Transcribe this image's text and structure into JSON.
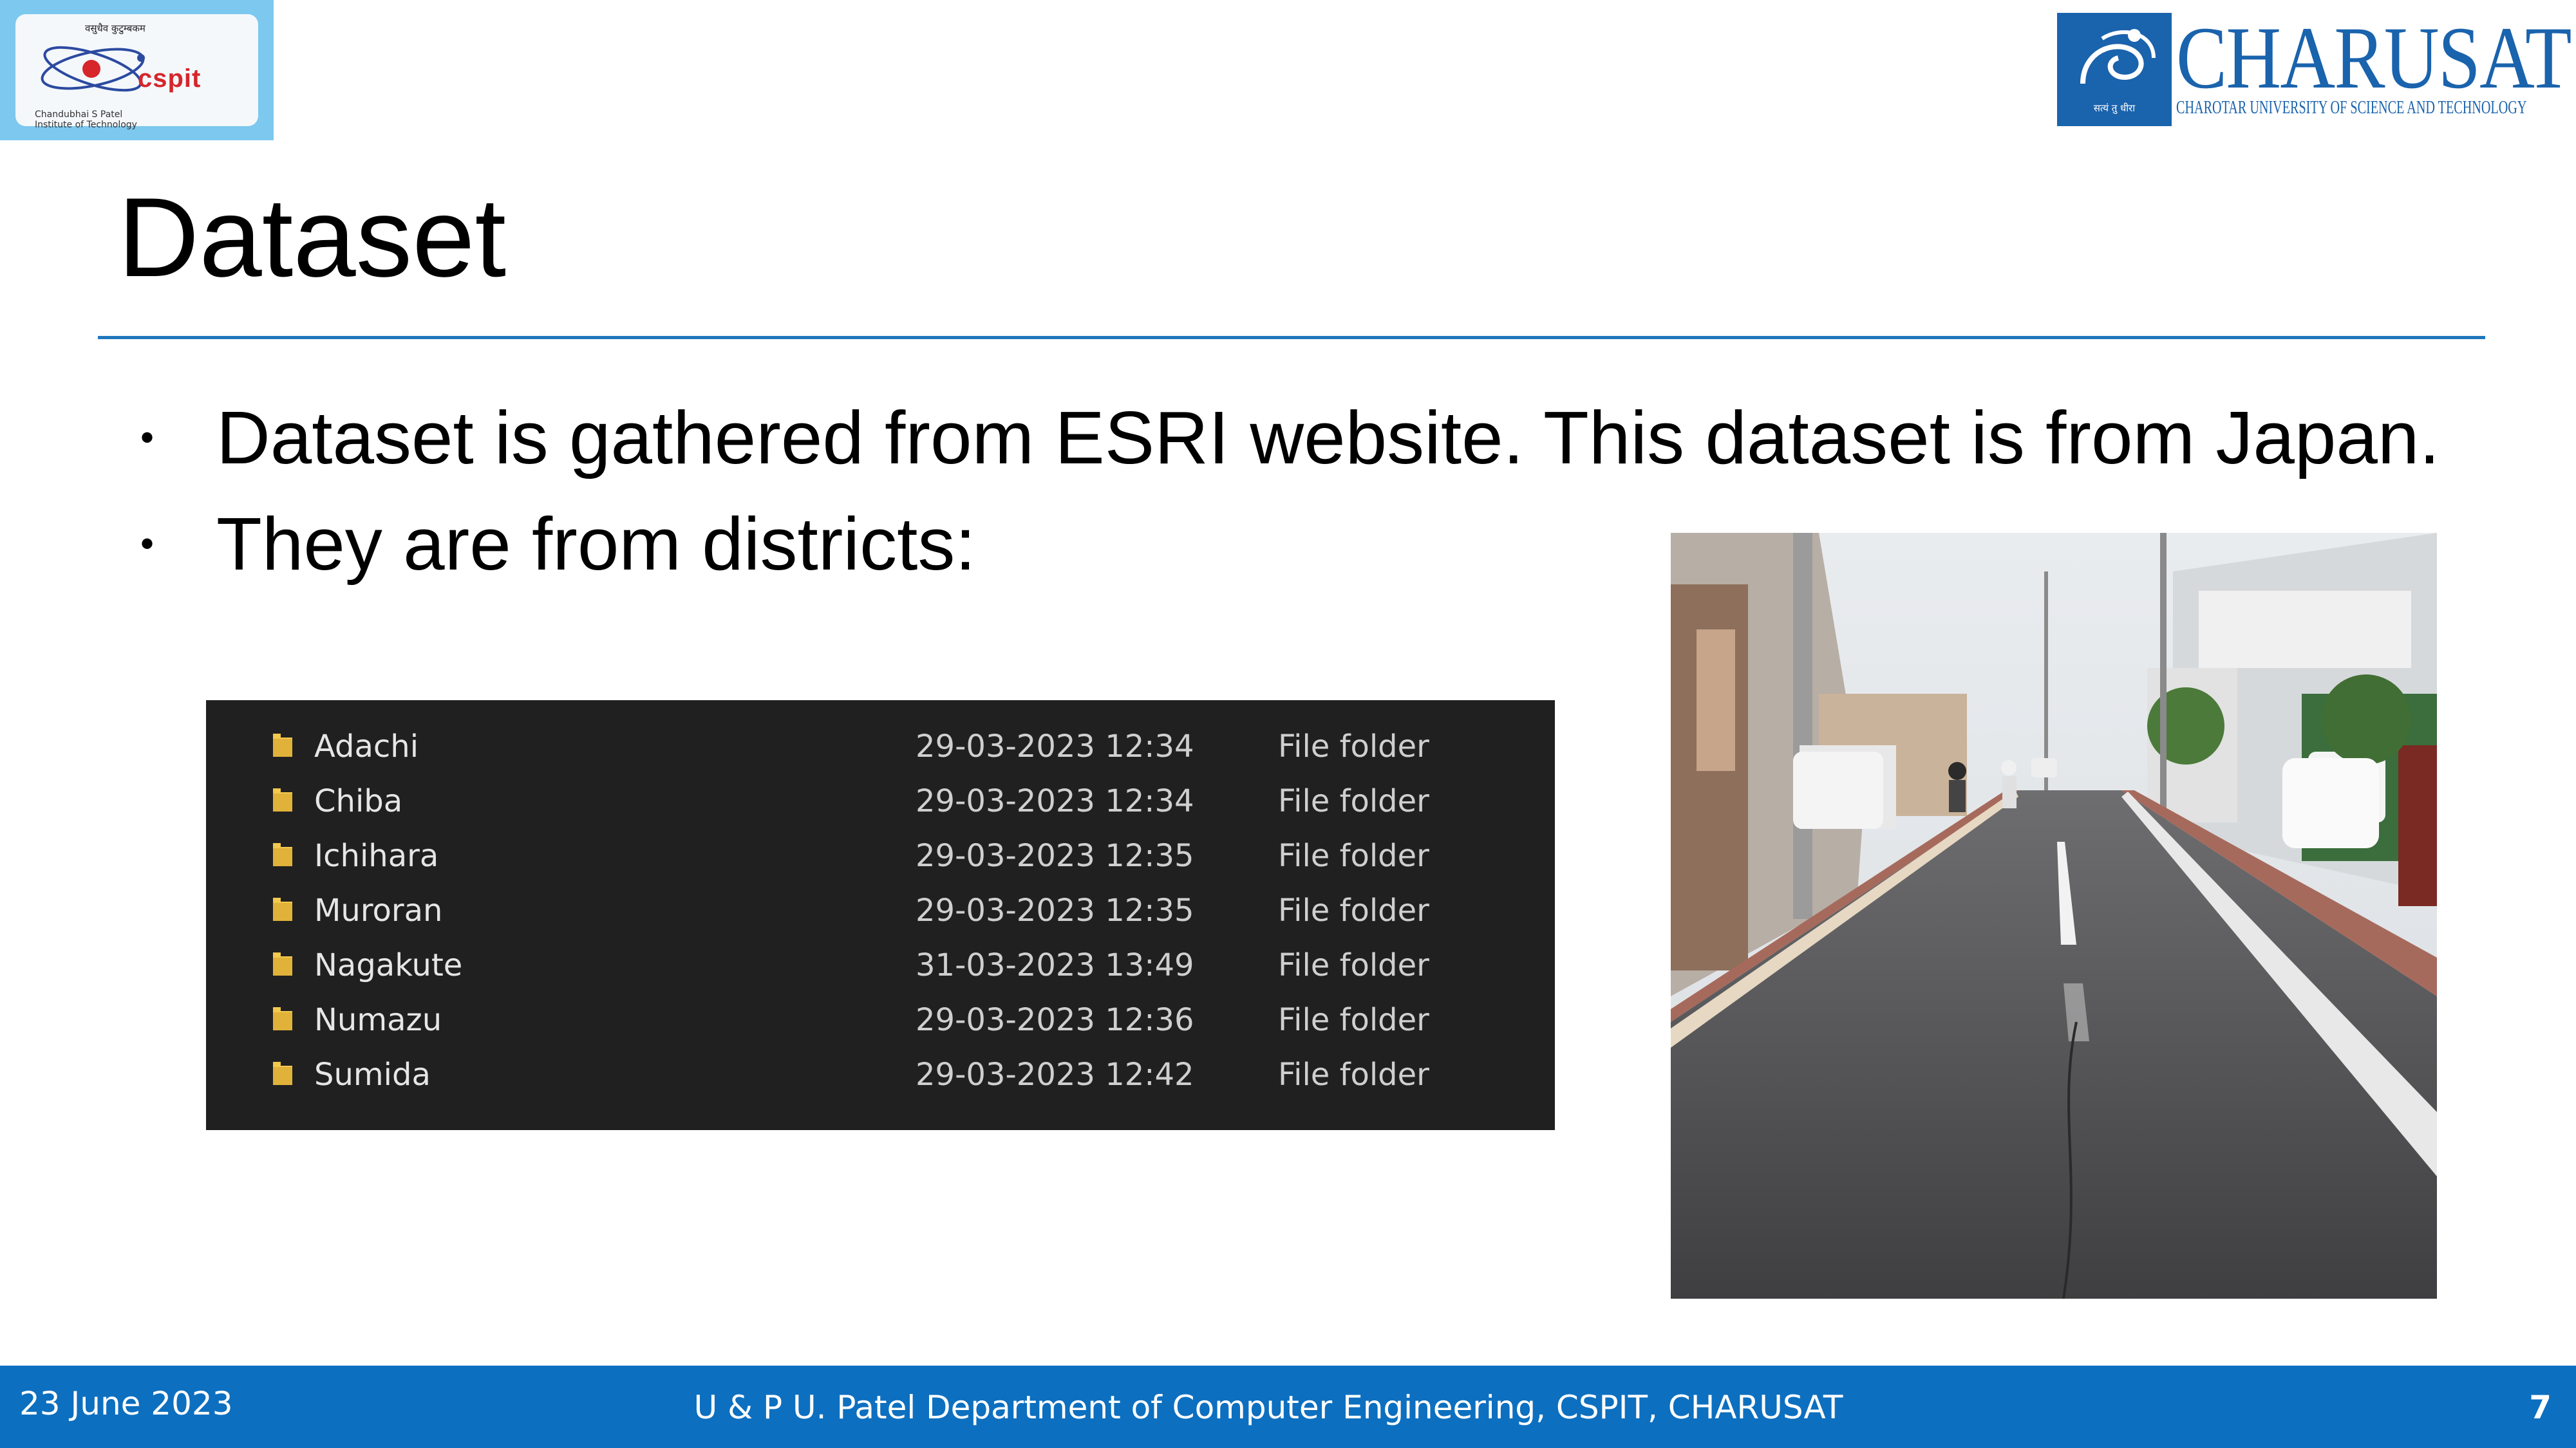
{
  "header": {
    "left_logo": {
      "tagline": "वसुधैव कुटुम्बकम",
      "brand": "cspit",
      "subtitle_line1": "Chandubhai S Patel",
      "subtitle_line2": "Institute of Technology"
    },
    "right_logo": {
      "wordmark": "CHARUSAT",
      "fullname": "CHAROTAR UNIVERSITY OF SCIENCE AND TECHNOLOGY",
      "emblem_caption": "सत्यं तु धीरा"
    }
  },
  "slide": {
    "title": "Dataset",
    "bullets": [
      "Dataset is gathered from ESRI website. This dataset is from Japan.",
      "They are from districts:"
    ]
  },
  "explorer": {
    "rows": [
      {
        "name": "Adachi",
        "date": "29-03-2023 12:34",
        "type": "File folder"
      },
      {
        "name": "Chiba",
        "date": "29-03-2023 12:34",
        "type": "File folder"
      },
      {
        "name": "Ichihara",
        "date": "29-03-2023 12:35",
        "type": "File folder"
      },
      {
        "name": "Muroran",
        "date": "29-03-2023 12:35",
        "type": "File folder"
      },
      {
        "name": "Nagakute",
        "date": "31-03-2023 13:49",
        "type": "File folder"
      },
      {
        "name": "Numazu",
        "date": "29-03-2023 12:36",
        "type": "File folder"
      },
      {
        "name": "Sumida",
        "date": "29-03-2023 12:42",
        "type": "File folder"
      }
    ]
  },
  "footer": {
    "date": "23 June 2023",
    "department": "U & P U. Patel Department of Computer Engineering, CSPIT, CHARUSAT",
    "page": "7"
  },
  "colors": {
    "accent": "#1f77bd",
    "footer_bg": "#0d6fbf",
    "explorer_bg": "#202020",
    "folder_yellow": "#f2c94c"
  }
}
